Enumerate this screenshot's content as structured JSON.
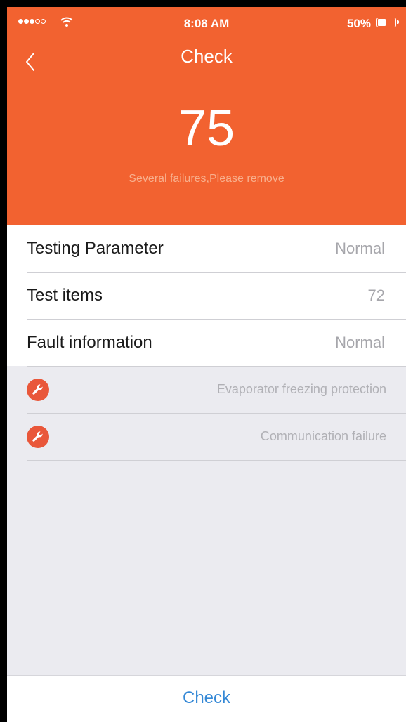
{
  "status_bar": {
    "time": "8:08 AM",
    "battery_percent": "50%",
    "signal_bars": 3,
    "battery_level": 0.5
  },
  "header": {
    "title": "Check",
    "score": "75",
    "message": "Several failures,Please remove",
    "background": "#f26230"
  },
  "info_rows": [
    {
      "label": "Testing Parameter",
      "value": "Normal"
    },
    {
      "label": "Test items",
      "value": "72"
    },
    {
      "label": "Fault information",
      "value": "Normal"
    }
  ],
  "faults": [
    {
      "icon": "wrench-icon",
      "text": "Evaporator freezing protection"
    },
    {
      "icon": "wrench-icon",
      "text": "Communication failure"
    }
  ],
  "bottom": {
    "button_label": "Check",
    "accent": "#3488d6"
  }
}
